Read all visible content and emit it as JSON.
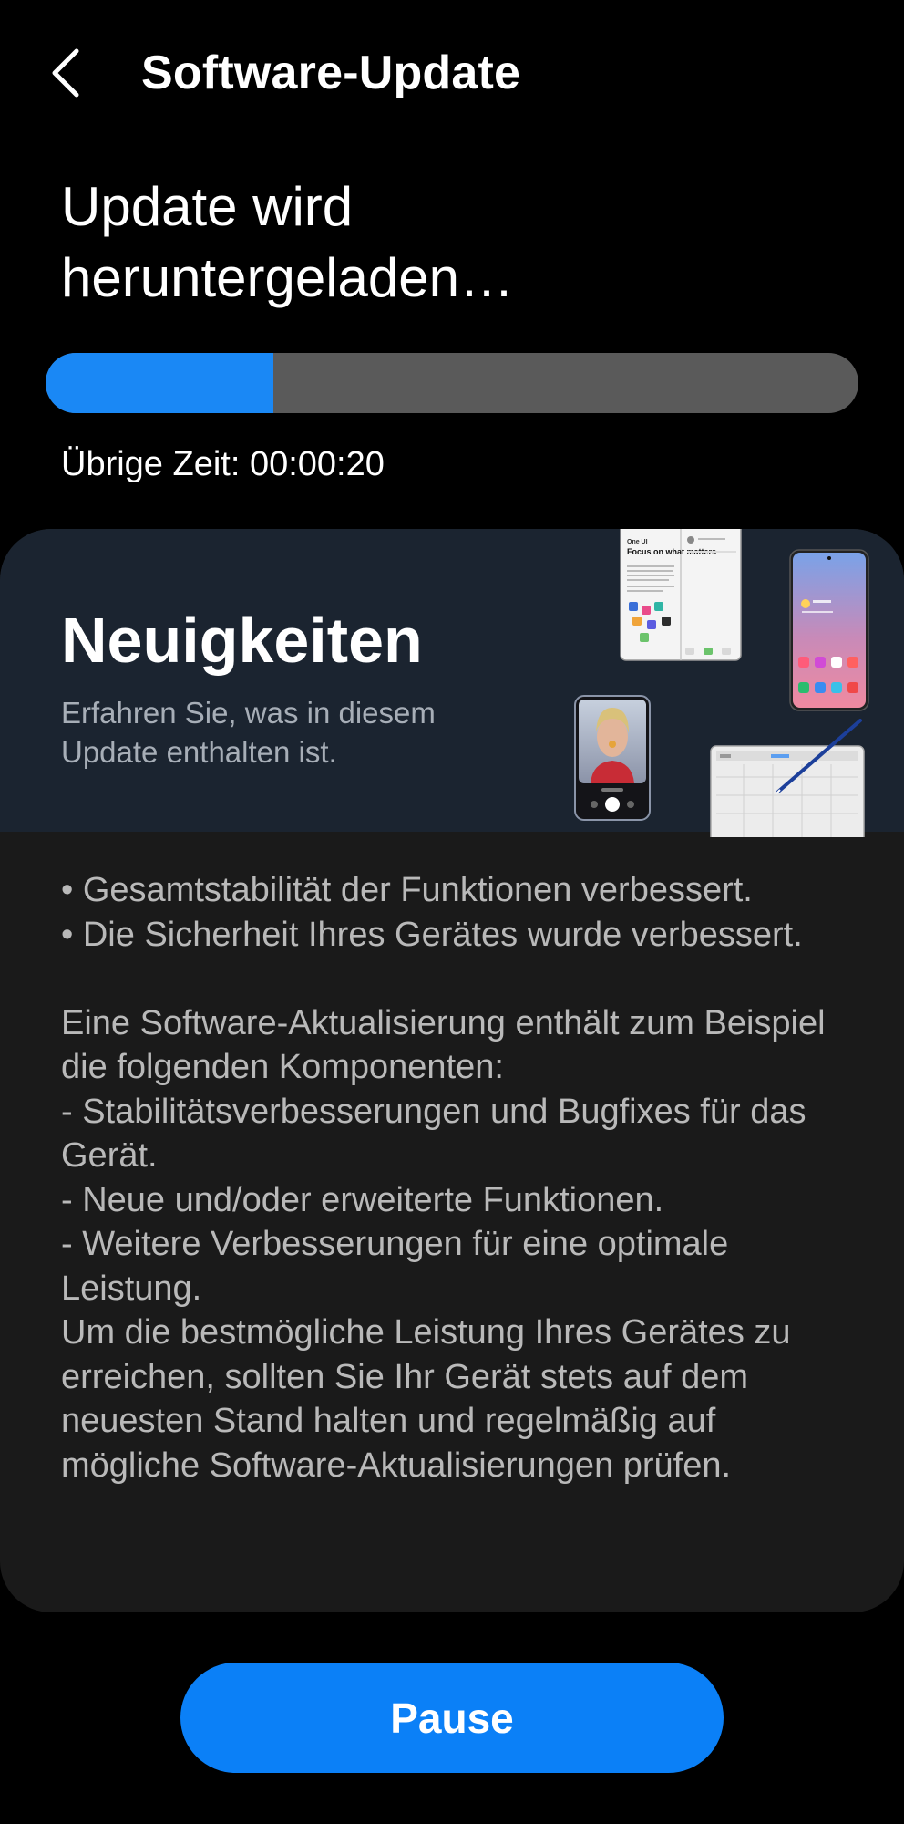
{
  "header": {
    "title": "Software-Update",
    "back_icon": "chevron-left-icon"
  },
  "download": {
    "status_line1": "Update wird",
    "status_line2": "heruntergeladen…",
    "progress_fraction": 0.28,
    "remaining_label": "Übrige Zeit: 00:00:20"
  },
  "news": {
    "title": "Neuigkeiten",
    "subtitle": "Erfahren Sie, was in diesem Update enthalten ist.",
    "tablet_headline": "Focus on what matters",
    "tablet_brand": "One UI",
    "body": "• Gesamtstabilität der Funktionen verbessert.\n• Die Sicherheit Ihres Gerätes wurde verbessert.\n\nEine Software-Aktualisierung enthält zum Beispiel die folgenden Komponenten:\n - Stabilitätsverbesserungen und Bugfixes für das Gerät.\n - Neue und/oder erweiterte Funktionen.\n - Weitere Verbesserungen für eine optimale Leistung.\nUm die bestmögliche Leistung Ihres Gerätes zu erreichen, sollten Sie Ihr Gerät stets auf dem neuesten Stand halten und regelmäßig auf mögliche Software-Aktualisierungen prüfen."
  },
  "actions": {
    "pause_label": "Pause"
  },
  "colors": {
    "accent": "#0b80f7",
    "progress_fill": "#1a88f5",
    "track": "#5a5a5a",
    "banner": "#1b2430",
    "card": "#1a1a1a"
  }
}
